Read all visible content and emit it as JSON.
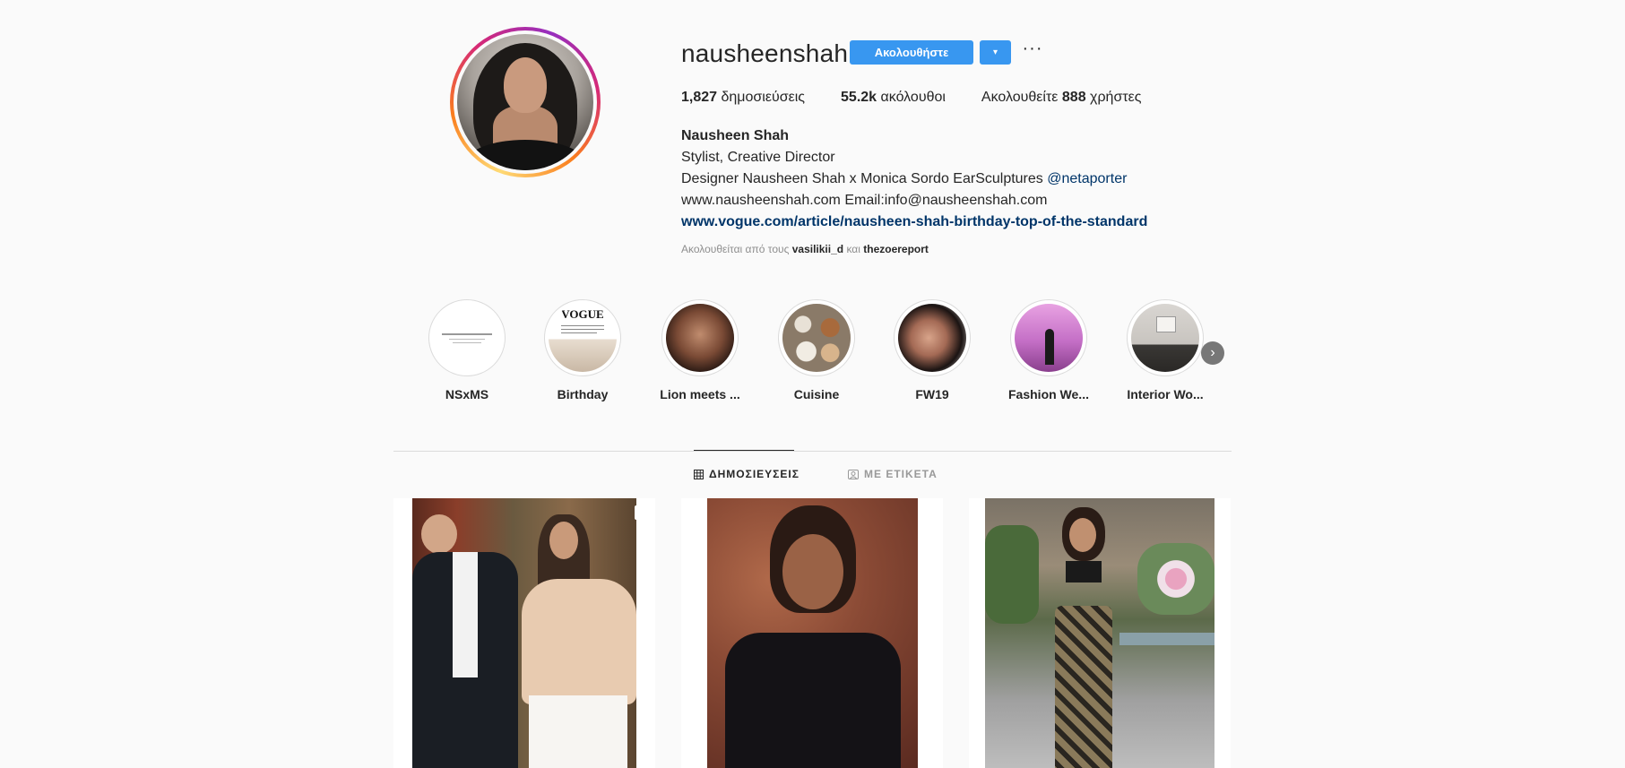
{
  "profile": {
    "username": "nausheenshah",
    "follow_label": "Ακολουθήστε",
    "dropdown_glyph": "▾",
    "more_glyph": "···",
    "stats": {
      "posts_count": "1,827",
      "posts_label": "δημοσιεύσεις",
      "followers_count": "55.2k",
      "followers_label": "ακόλουθοι",
      "following_prefix": "Ακολουθείτε",
      "following_count": "888",
      "following_suffix": "χρήστες"
    },
    "bio": {
      "full_name": "Nausheen Shah",
      "line1": "Stylist, Creative Director",
      "line2_text": "Designer Nausheen Shah x Monica Sordo EarSculptures",
      "line2_mention": "@netaporter",
      "line3": "www.nausheenshah.com Email:info@nausheenshah.com",
      "link": "www.vogue.com/article/nausheen-shah-birthday-top-of-the-standard"
    },
    "followed_by": {
      "prefix": "Ακολουθείται από τους",
      "user1": "vasilikii_d",
      "joiner": "και",
      "user2": "thezoereport"
    }
  },
  "highlights": [
    {
      "label": "NSxMS"
    },
    {
      "label": "Birthday",
      "cover_text": "VOGUE"
    },
    {
      "label": "Lion meets ..."
    },
    {
      "label": "Cuisine"
    },
    {
      "label": "FW19"
    },
    {
      "label": "Fashion We..."
    },
    {
      "label": "Interior Wo..."
    }
  ],
  "highlights_next_glyph": "›",
  "tabs": [
    {
      "label": "ΔΗΜΟΣΙΕΥΣΕΙΣ",
      "icon": "grid-icon",
      "active": true
    },
    {
      "label": "ΜΕ ΕΤΙΚΕΤΑ",
      "icon": "tagged-icon",
      "active": false
    }
  ],
  "colors": {
    "accent": "#3897f0",
    "link": "#003569",
    "muted": "#8e8e8e",
    "background": "#fafafa"
  }
}
